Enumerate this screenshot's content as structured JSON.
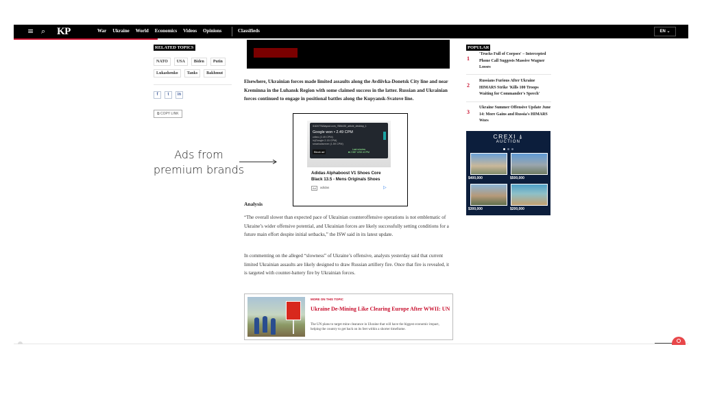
{
  "nav": {
    "menu_icon": "≡",
    "search_icon": "⌕",
    "logo": "KP",
    "items": [
      "War",
      "Ukraine",
      "World",
      "Economics",
      "Videos",
      "Opinions"
    ],
    "classifieds": "Classifieds",
    "lang": "EN ⌄"
  },
  "related_topics": {
    "title": "RELATED TOPICS",
    "tags": [
      "NATO",
      "USA",
      "Biden",
      "Putin",
      "Lukashenko",
      "Tanks",
      "Bakhmut"
    ]
  },
  "share": {
    "icons": [
      "f",
      "t",
      "in"
    ],
    "copy_link": "⧉ COPY LINK"
  },
  "article": {
    "para1": "Elsewhere, Ukrainian forces made limited assaults along the Avdiivka-Donetsk City line and near Kreminna in the Luhansk Region with some claimed success in the latter. Russian and Ukrainian forces continued to engage in positional battles along the Kupyansk-Svatove line.",
    "analysis_heading": "Analysis",
    "para2": "“The overall slower than expected pace of Ukrainian counteroffensive operations is not emblematic of Ukraine’s wider offensive potential, and Ukrainian forces are likely successfully setting conditions for a future main effort despite initial setbacks,” the ISW said in its latest update.",
    "para3": "In commenting on the alleged “slowness” of Ukraine’s offensive, analysts yesterday said that current limited Ukrainian assaults are likely designed to draw Russian artillery fire. Once that fire is revealed, it is targeted with counter-battery fire by Ukrainian forces."
  },
  "ad": {
    "popup_url": "i1624776&layout.com_7884430_article_desktop_1",
    "popup_win": "Google won • 2.49 CPM",
    "popup_lines": [
      "criteo (2.49 CPM)",
      "ix(Google 2.15 CPM)",
      "smartadserver (1.59 CPM)"
    ],
    "popup_block": "Block ad",
    "popup_last": "Last window\n■ 2.587 USD eCPM",
    "title": "Adidas Alphaboost V1 Shoes Core Black 13.5 - Mens Originals Shoes",
    "badge": "Ad",
    "brand": "adidas",
    "play_icon": "▷"
  },
  "more_on_topic": {
    "label": "MORE ON THIS TOPIC",
    "title": "Ukraine De-Mining Like Clearing Europe After WWII: UN",
    "desc": "The UN plans to target mine clearance in Ukraine that will have the biggest economic impact, helping the country to get back on its feet within a shorter timeframe."
  },
  "popular": {
    "title": "POPULAR",
    "items": [
      {
        "num": "1",
        "text": "'Trucks Full of Corpses' – Intercepted Phone Call Suggests Massive Wagner Losses"
      },
      {
        "num": "2",
        "text": "Russians Furious After Ukraine HIMARS Strike 'Kills 100 Troops Waiting for Commander's Speech'"
      },
      {
        "num": "3",
        "text": "Ukraine Summer Offensive Update June 14: More Gains and Russia's HIMARS Woes"
      }
    ]
  },
  "crexi": {
    "logo": "CREXI ⍋",
    "sub": "AUCTION",
    "prices": [
      "$400,000",
      "$500,000",
      "$300,000",
      "$200,000"
    ]
  },
  "annotation": {
    "line1": "Ads from",
    "line2": "premium brands"
  },
  "colors": {
    "accent_red": "#c8102e",
    "nav_bg": "#000000",
    "crexi_bg": "#0c1e3c"
  }
}
